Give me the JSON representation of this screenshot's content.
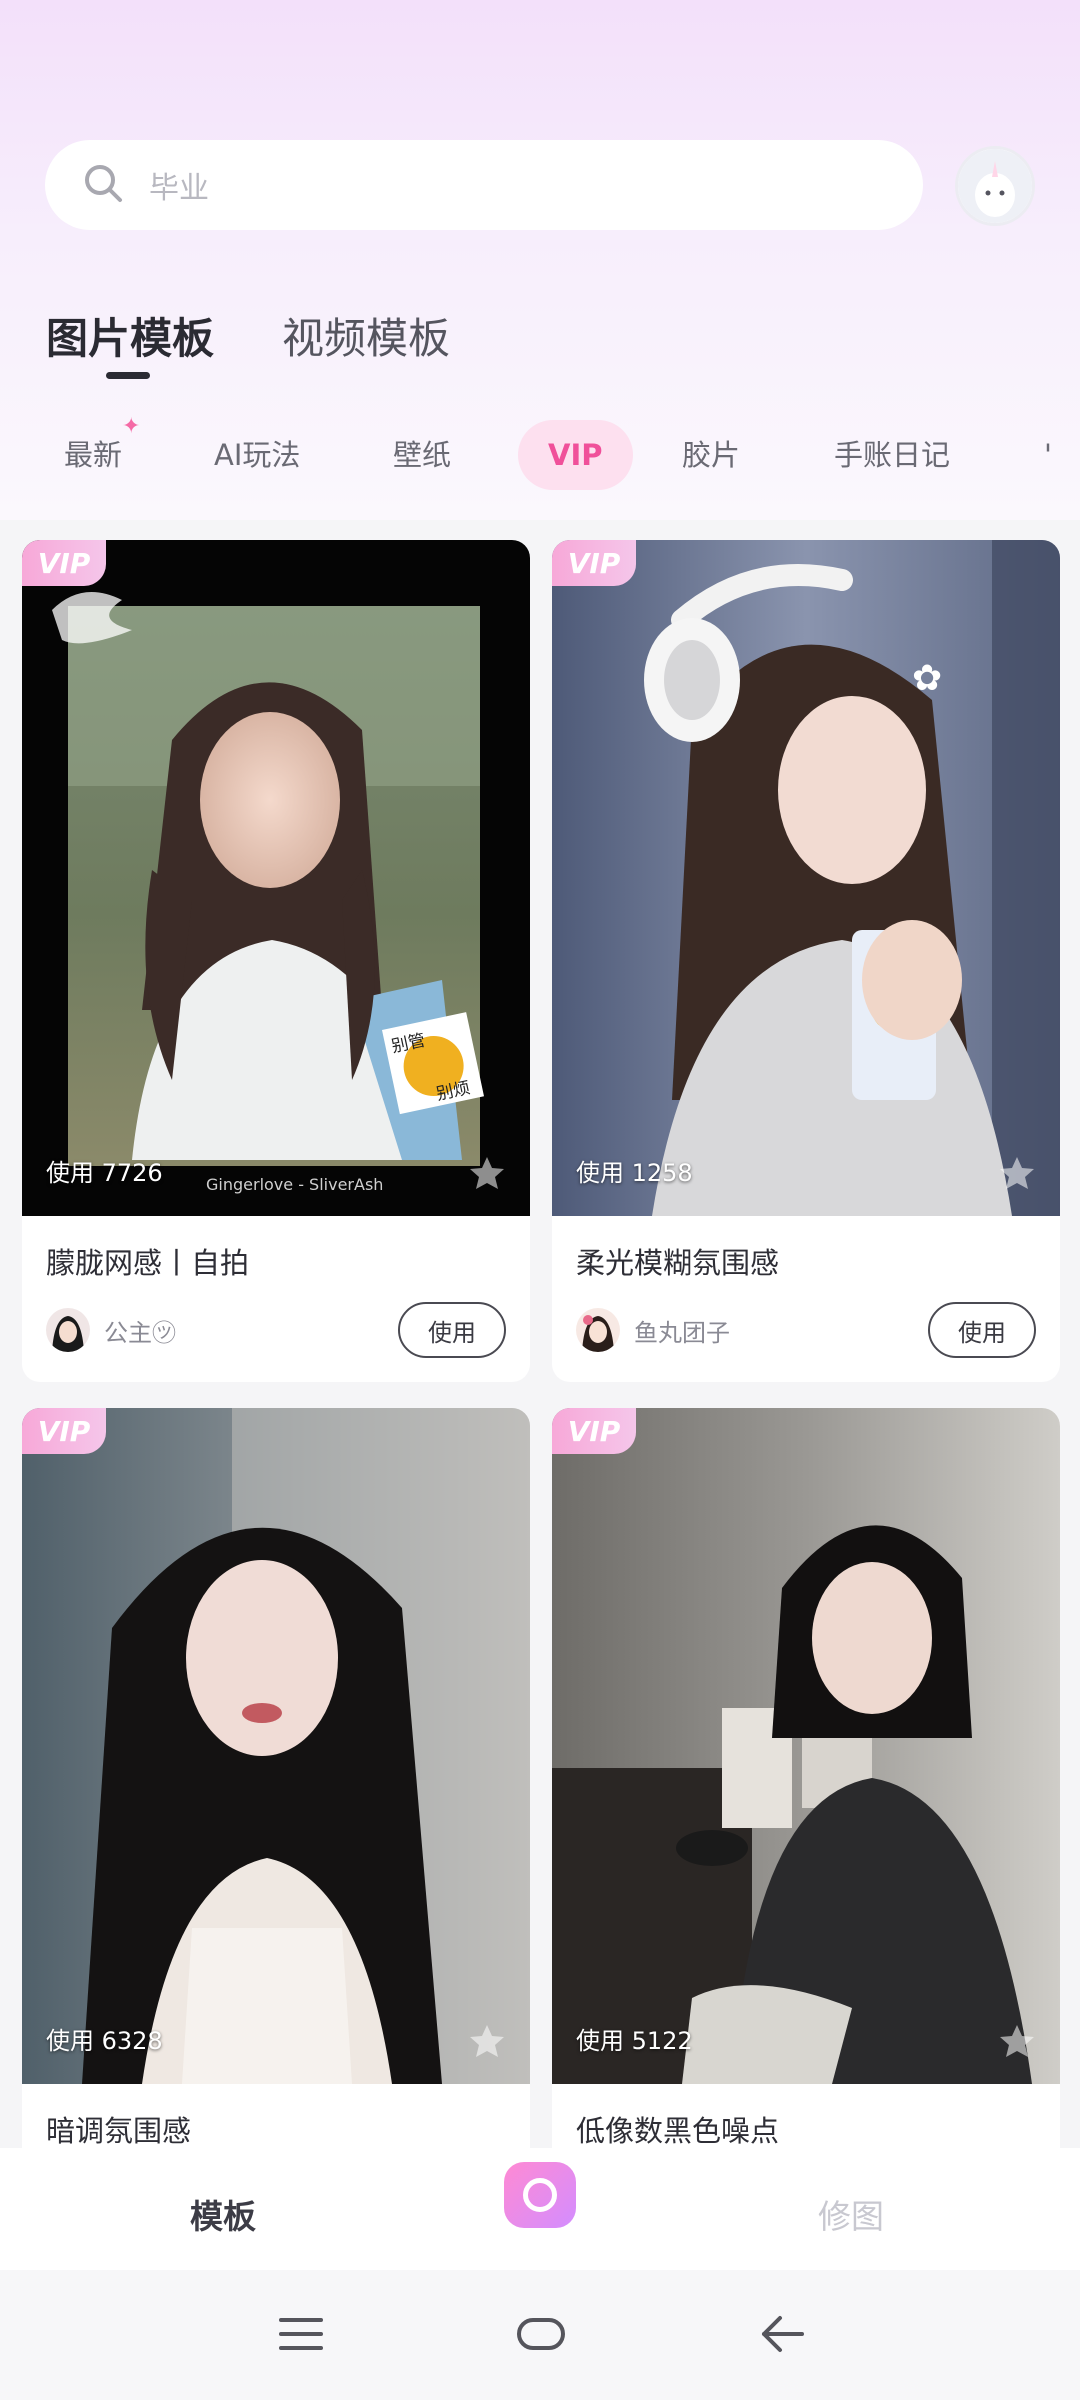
{
  "search": {
    "placeholder": "毕业"
  },
  "main_tabs": [
    {
      "label": "图片模板",
      "active": true
    },
    {
      "label": "视频模板",
      "active": false
    }
  ],
  "categories": [
    {
      "label": "最新",
      "has_star": true
    },
    {
      "label": "AI玩法"
    },
    {
      "label": "壁纸"
    },
    {
      "label": "VIP",
      "selected": true
    },
    {
      "label": "胶片"
    },
    {
      "label": "手账日记"
    },
    {
      "label": "'"
    }
  ],
  "cards": [
    {
      "badge": "VIP",
      "uses": "使用 7726",
      "title": "朦胧网感丨自拍",
      "author": "公主㋡",
      "button": "使用",
      "watermark": "Gingerlove - SliverAsh",
      "sticker_top": "别管",
      "sticker_bottom": "别烦"
    },
    {
      "badge": "VIP",
      "uses": "使用 1258",
      "title": "柔光模糊氛围感",
      "author": "鱼丸团子",
      "button": "使用"
    },
    {
      "badge": "VIP",
      "uses": "使用 6328",
      "title": "暗调氛围感"
    },
    {
      "badge": "VIP",
      "uses": "使用 5122",
      "title": "低像数黑色噪点"
    }
  ],
  "bottom_nav": {
    "templates": "模板",
    "retouch": "修图"
  },
  "colors": {
    "accent_pink": "#f0509a",
    "vip_badge": "#f7a8d8"
  }
}
